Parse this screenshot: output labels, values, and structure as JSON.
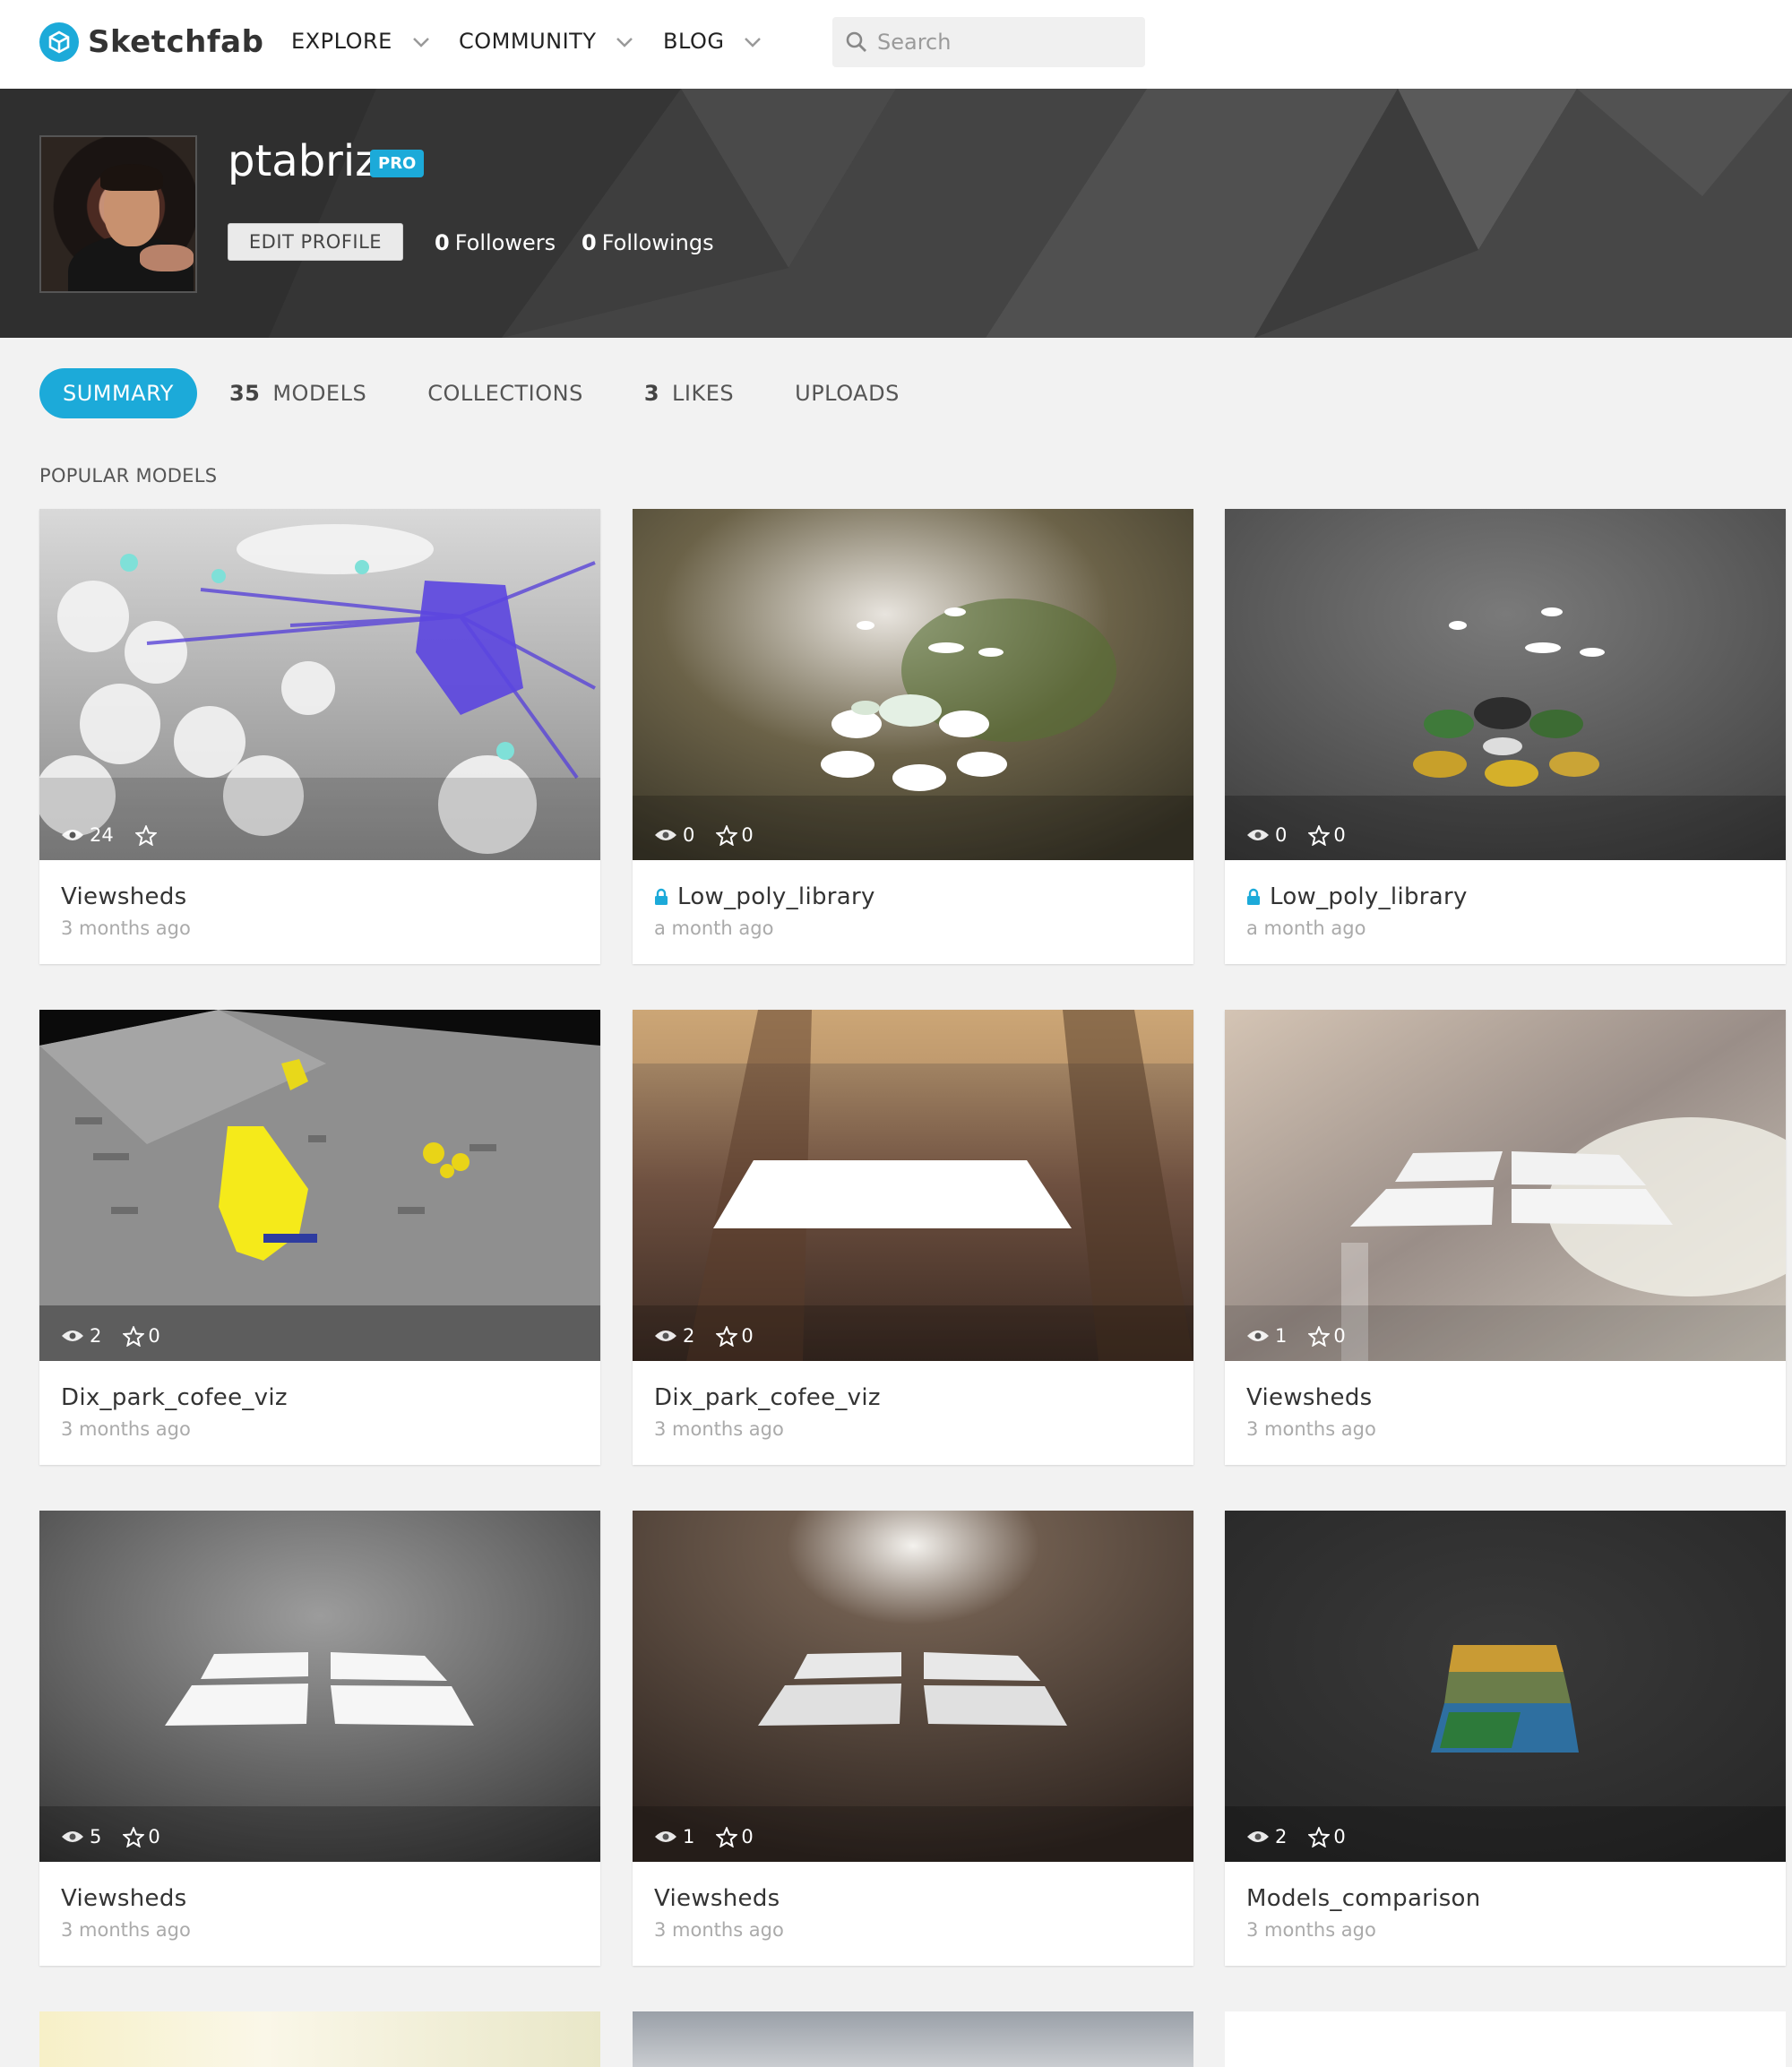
{
  "nav": {
    "brand": "Sketchfab",
    "items": [
      "EXPLORE",
      "COMMUNITY",
      "BLOG"
    ],
    "search_placeholder": "Search"
  },
  "profile": {
    "username": "ptabriz",
    "badge": "PRO",
    "edit_label": "EDIT PROFILE",
    "followers_count": "0",
    "followers_label": "Followers",
    "followings_count": "0",
    "followings_label": "Followings"
  },
  "tabs": {
    "summary": "SUMMARY",
    "models_count": "35",
    "models": "MODELS",
    "collections": "COLLECTIONS",
    "likes_count": "3",
    "likes": "LIKES",
    "uploads": "UPLOADS"
  },
  "section_title": "POPULAR MODELS",
  "models": [
    {
      "title": "Viewsheds",
      "time": "3 months ago",
      "views": "24",
      "likes": "",
      "private": false
    },
    {
      "title": "Low_poly_library",
      "time": "a month ago",
      "views": "0",
      "likes": "0",
      "private": true
    },
    {
      "title": "Low_poly_library",
      "time": "a month ago",
      "views": "0",
      "likes": "0",
      "private": true
    },
    {
      "title": "Dix_park_cofee_viz",
      "time": "3 months ago",
      "views": "2",
      "likes": "0",
      "private": false
    },
    {
      "title": "Dix_park_cofee_viz",
      "time": "3 months ago",
      "views": "2",
      "likes": "0",
      "private": false
    },
    {
      "title": "Viewsheds",
      "time": "3 months ago",
      "views": "1",
      "likes": "0",
      "private": false
    },
    {
      "title": "Viewsheds",
      "time": "3 months ago",
      "views": "5",
      "likes": "0",
      "private": false
    },
    {
      "title": "Viewsheds",
      "time": "3 months ago",
      "views": "1",
      "likes": "0",
      "private": false
    },
    {
      "title": "Models_comparison",
      "time": "3 months ago",
      "views": "2",
      "likes": "0",
      "private": false
    }
  ],
  "colors": {
    "accent": "#1caad9",
    "banner": "#3a3a3a"
  },
  "icons": [
    "logo-icon",
    "chevron-down-icon",
    "search-icon",
    "eye-icon",
    "star-icon",
    "lock-icon"
  ]
}
